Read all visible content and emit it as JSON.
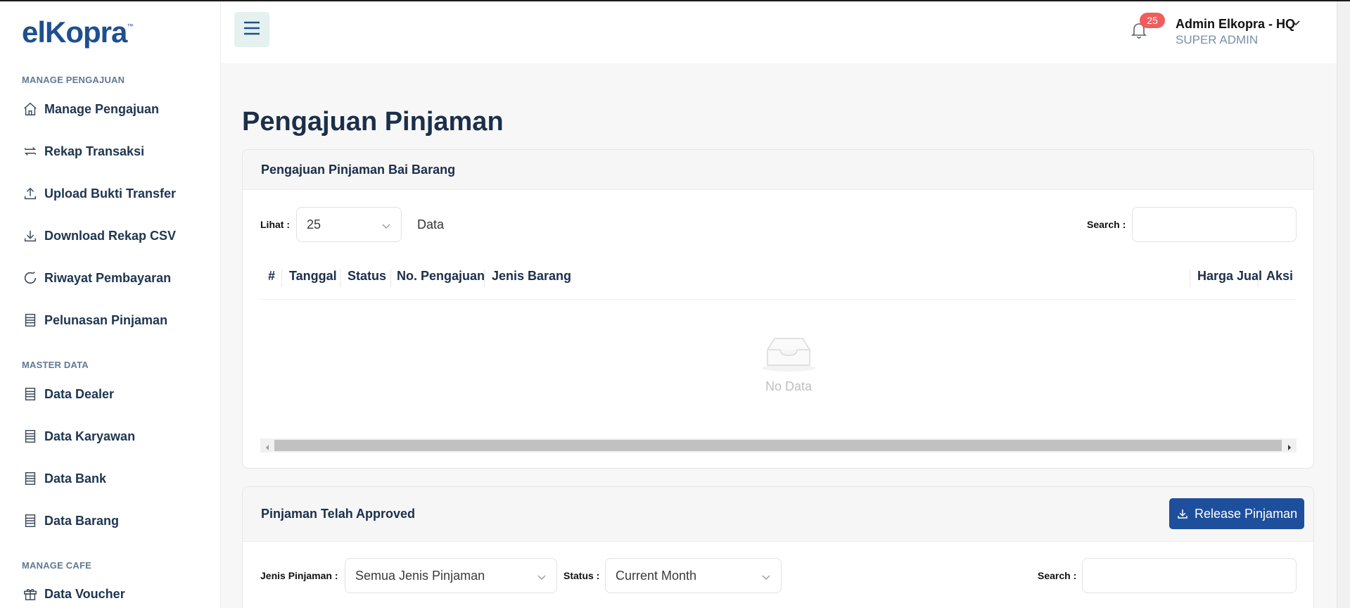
{
  "app": {
    "logo_text": "elKopra",
    "logo_tm": "™"
  },
  "header": {
    "notification_count": "25",
    "user_name": "Admin Elkopra - HQ",
    "user_role": "SUPER ADMIN"
  },
  "sidebar": {
    "sections": [
      {
        "title": "MANAGE PENGAJUAN",
        "items": [
          {
            "label": "Manage Pengajuan",
            "icon": "home-icon"
          },
          {
            "label": "Rekap Transaksi",
            "icon": "repeat-icon"
          },
          {
            "label": "Upload Bukti Transfer",
            "icon": "upload-icon"
          },
          {
            "label": "Download Rekap CSV",
            "icon": "download-icon"
          },
          {
            "label": "Riwayat Pembayaran",
            "icon": "refresh-icon"
          },
          {
            "label": "Pelunasan Pinjaman",
            "icon": "list-icon"
          }
        ]
      },
      {
        "title": "MASTER DATA",
        "items": [
          {
            "label": "Data Dealer",
            "icon": "list-icon"
          },
          {
            "label": "Data Karyawan",
            "icon": "list-icon"
          },
          {
            "label": "Data Bank",
            "icon": "list-icon"
          },
          {
            "label": "Data Barang",
            "icon": "list-icon"
          }
        ]
      },
      {
        "title": "MANAGE CAFE",
        "items": [
          {
            "label": "Data Voucher",
            "icon": "gift-icon"
          }
        ]
      }
    ]
  },
  "main": {
    "page_title": "Pengajuan Pinjaman",
    "card1": {
      "title": "Pengajuan Pinjaman Bai Barang",
      "lihat_label": "Lihat :",
      "lihat_value": "25",
      "data_label": "Data",
      "search_label": "Search :",
      "search_value": "",
      "columns": [
        "#",
        "Tanggal",
        "Status",
        "No. Pengajuan",
        "Jenis Barang",
        "Harga Jual",
        "Aksi"
      ],
      "rows": [],
      "empty_text": "No Data"
    },
    "card2": {
      "title": "Pinjaman Telah Approved",
      "release_button": "Release Pinjaman",
      "jenis_label": "Jenis Pinjaman :",
      "jenis_value": "Semua Jenis Pinjaman",
      "status_label": "Status :",
      "status_value": "Current Month",
      "search_label": "Search :",
      "search_value": ""
    }
  },
  "colors": {
    "brand": "#1e4f8f",
    "primary_button": "#1e4f9c",
    "badge": "#f05d5d",
    "hamburger_bg": "#e4f1ee"
  }
}
